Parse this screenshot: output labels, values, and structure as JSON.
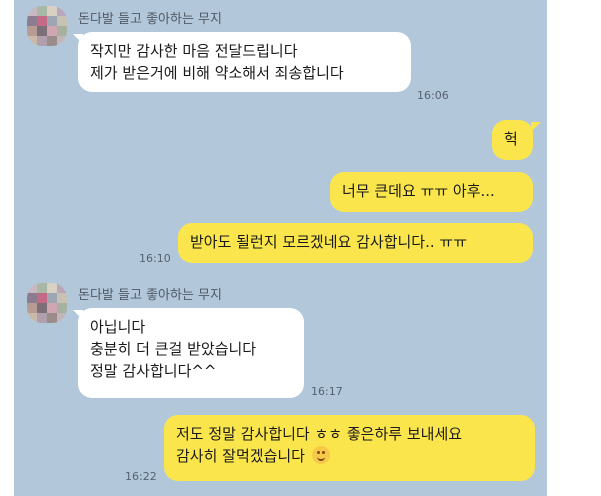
{
  "sender": {
    "name": "돈다발 들고 좋아하는 무지"
  },
  "messages": [
    {
      "lines": [
        "작지만 감사한 마음 전달드립니다",
        "제가 받은거에 비해 약소해서 죄송합니다"
      ],
      "time": "16:06"
    },
    {
      "lines": [
        "헉"
      ]
    },
    {
      "lines": [
        "너무 큰데요 ㅠㅠ 아후..."
      ]
    },
    {
      "lines": [
        "받아도 될런지 모르겠네요 감사합니다.. ㅠㅠ"
      ],
      "time": "16:10"
    },
    {
      "lines": [
        "아닙니다",
        "충분히 더 큰걸 받았습니다",
        "정말 감사합니다^^"
      ],
      "time": "16:17"
    },
    {
      "lines": [
        "저도 정말 감사합니다 ㅎㅎ 좋은하루 보내세요",
        "감사히 잘먹겠습니다"
      ],
      "time": "16:22"
    }
  ],
  "icons": {
    "emoji": "smiling-face-emoji"
  },
  "colors": {
    "background": "#b2c7da",
    "incoming": "#ffffff",
    "outgoing": "#fae64c"
  }
}
